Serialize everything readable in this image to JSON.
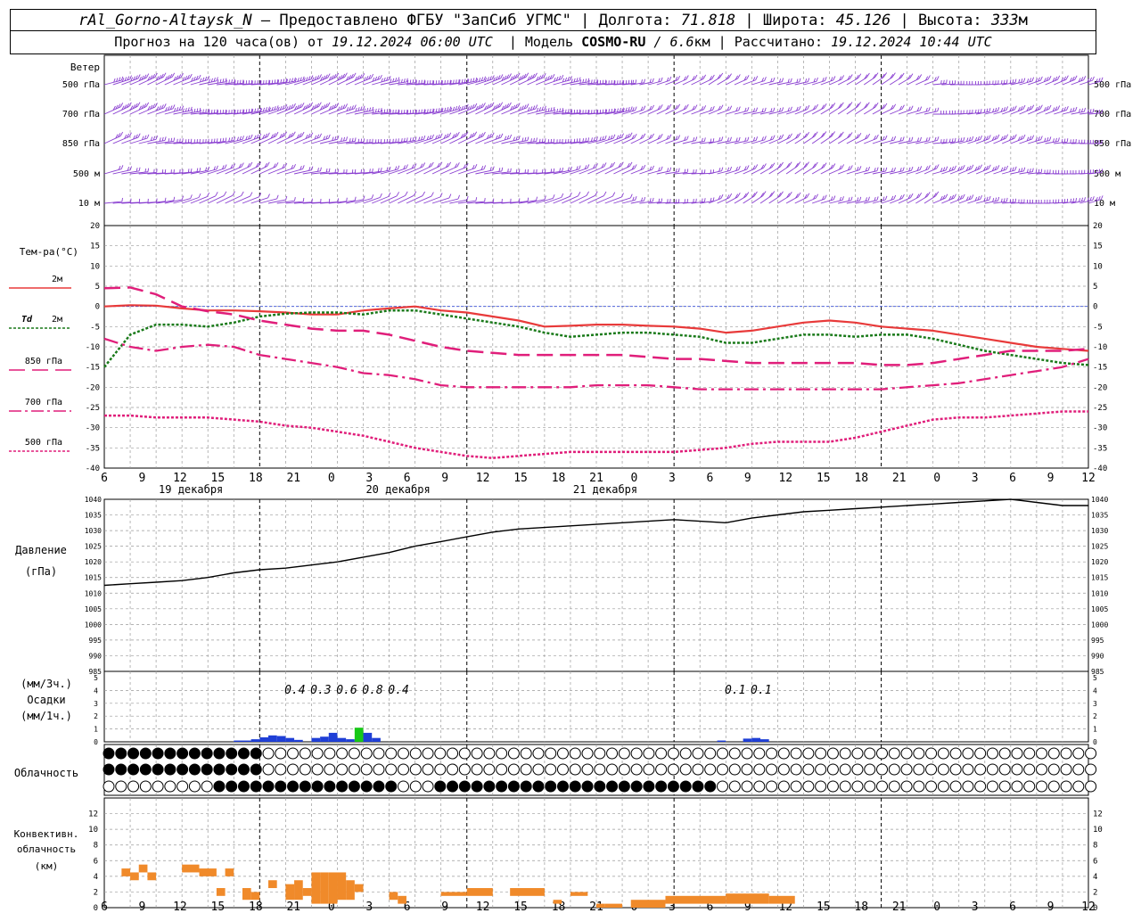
{
  "header": {
    "station": "rAl_Gorno-Altaysk_N",
    "provider": "— Предоставлено ФГБУ \"ЗапСиб УГМС\"",
    "lon_label": "| Долгота:",
    "lon_value": "71.818",
    "lat_label": "| Широта:",
    "lat_value": "45.126",
    "alt_label": "| Высота:",
    "alt_value": "333",
    "alt_unit": "м",
    "forecast_label": "Прогноз на 120 часа(ов) от",
    "forecast_from": "19.12.2024 06:00 UTC",
    "model_label": "| Модель",
    "model_name": "COSMO-RU",
    "model_res": "/ 6.6",
    "model_res_unit": "км",
    "calc_label": "| Рассчитано:",
    "calc_time": "19.12.2024 10:44 UTC"
  },
  "colors": {
    "wind": "#8a3fd1",
    "t2m": "#e83a3a",
    "td2m": "#1a7a1a",
    "t850": "#e01e7a",
    "t700": "#e01e7a",
    "t500": "#e01e7a",
    "zero_line": "#3a50d8",
    "pressure": "#000000",
    "precip_blue": "#1f3fd6",
    "precip_green": "#18c818",
    "conv_cloud": "#f08a2a",
    "grid": "#9a9a9a"
  },
  "wind_panel": {
    "title": "Ветер",
    "levels": [
      "500 гПа",
      "700 гПа",
      "850 гПа",
      "500 м",
      "10 м"
    ]
  },
  "temp_panel": {
    "title": "Тем-ра(°C)",
    "legend": {
      "t2m": "2м",
      "td_sym": "Td",
      "td": "2м",
      "t850": "850 гПа",
      "t700": "700 гПа",
      "t500": "500 гПа"
    }
  },
  "time_axis": {
    "tick_labels": [
      "6",
      "9",
      "12",
      "15",
      "18",
      "21",
      "0",
      "3",
      "6",
      "9",
      "12",
      "15",
      "18",
      "21",
      "0",
      "3",
      "6",
      "9",
      "12",
      "15",
      "18",
      "21",
      "0",
      "3",
      "6",
      "9",
      "12"
    ],
    "day_labels": [
      "19 декабря",
      "20 декабря",
      "21 декабря"
    ]
  },
  "pressure_panel": {
    "title": "Давление",
    "unit": "(гПа)"
  },
  "precip_panel": {
    "unit3": "(мм/3ч.)",
    "title": "Осадки",
    "unit1": "(мм/1ч.)",
    "totals": [
      {
        "hour": 21,
        "value": "0.4"
      },
      {
        "hour": 24,
        "value": "0.3"
      },
      {
        "hour": 27,
        "value": "0.6"
      },
      {
        "hour": 30,
        "value": "0.8"
      },
      {
        "hour": 33,
        "value": "0.4"
      },
      {
        "hour": 72,
        "value": "0.1"
      },
      {
        "hour": 75,
        "value": "0.1"
      }
    ]
  },
  "cloud_panel": {
    "title": "Облачность"
  },
  "conv_panel": {
    "title_line1": "Конвективн.",
    "title_line2": "облачность",
    "unit": "(км)"
  },
  "chart_data": [
    {
      "type": "line",
      "name": "temperature",
      "x_unit": "hours since 19.12.2024 06:00 UTC",
      "ylim": [
        -40,
        20
      ],
      "y_ticks": [
        20,
        15,
        10,
        5,
        0,
        -5,
        -10,
        -15,
        -20,
        -25,
        -30,
        -35,
        -40
      ],
      "x": [
        0,
        3,
        6,
        9,
        12,
        15,
        18,
        21,
        24,
        27,
        30,
        33,
        36,
        39,
        42,
        45,
        48,
        51,
        54,
        57,
        60,
        63,
        66,
        69,
        72,
        75,
        78,
        81,
        84,
        87,
        90,
        93,
        96,
        99,
        102,
        105,
        108,
        111,
        114
      ],
      "series": [
        {
          "key": "t2m",
          "values": [
            0,
            0.3,
            0.2,
            -0.5,
            -1,
            -1,
            -1.2,
            -1.5,
            -2,
            -2,
            -1,
            -0.5,
            0,
            -1,
            -1.5,
            -2.5,
            -3.5,
            -5,
            -4.8,
            -4.5,
            -4.5,
            -4.8,
            -5,
            -5.5,
            -6.5,
            -6,
            -5,
            -4,
            -3.5,
            -4,
            -5,
            -5.5,
            -6,
            -7,
            -8,
            -9,
            -10,
            -10.5,
            -11
          ]
        },
        {
          "key": "td2m",
          "values": [
            -15,
            -7,
            -4.5,
            -4.5,
            -5,
            -4,
            -2.5,
            -1.8,
            -1.5,
            -1.5,
            -2,
            -1,
            -1,
            -2,
            -3,
            -4,
            -5,
            -6.5,
            -7.5,
            -7,
            -6.5,
            -6.5,
            -7,
            -7.5,
            -9,
            -9,
            -8,
            -7,
            -7,
            -7.5,
            -7,
            -7,
            -8,
            -9.5,
            -11,
            -12,
            -13,
            -14,
            -14.5
          ]
        },
        {
          "key": "t850",
          "values": [
            4.5,
            4.7,
            3,
            0,
            -1.2,
            -2,
            -3.5,
            -4.5,
            -5.5,
            -6,
            -6,
            -7,
            -8.5,
            -10,
            -11,
            -11.5,
            -12,
            -12,
            -12,
            -12,
            -12,
            -12.5,
            -13,
            -13,
            -13.5,
            -14,
            -14,
            -14,
            -14,
            -14,
            -14.5,
            -14.5,
            -14,
            -13,
            -12,
            -11,
            -11,
            -11,
            -10.5
          ]
        },
        {
          "key": "t700",
          "values": [
            -8,
            -10,
            -11,
            -10,
            -9.5,
            -10,
            -12,
            -13,
            -14,
            -15,
            -16.5,
            -17,
            -18,
            -19.5,
            -20,
            -20,
            -20,
            -20,
            -20,
            -19.5,
            -19.5,
            -19.5,
            -20,
            -20.5,
            -20.5,
            -20.5,
            -20.5,
            -20.5,
            -20.5,
            -20.5,
            -20.5,
            -20,
            -19.5,
            -19,
            -18,
            -17,
            -16,
            -15,
            -13
          ]
        },
        {
          "key": "t500",
          "values": [
            -27,
            -27,
            -27.5,
            -27.5,
            -27.5,
            -28,
            -28.5,
            -29.5,
            -30,
            -31,
            -32,
            -33.5,
            -35,
            -36,
            -37,
            -37.5,
            -37,
            -36.5,
            -36,
            -36,
            -36,
            -36,
            -36,
            -35.5,
            -35,
            -34,
            -33.5,
            -33.5,
            -33.5,
            -32.5,
            -31,
            -29.5,
            -28,
            -27.5,
            -27.5,
            -27,
            -26.5,
            -26,
            -26
          ]
        }
      ]
    },
    {
      "type": "line",
      "name": "pressure",
      "ylim": [
        985,
        1040
      ],
      "y_ticks": [
        1040,
        1035,
        1030,
        1025,
        1020,
        1015,
        1010,
        1005,
        1000,
        995,
        990,
        985
      ],
      "x": [
        0,
        3,
        6,
        9,
        12,
        15,
        18,
        21,
        24,
        27,
        30,
        33,
        36,
        39,
        42,
        45,
        48,
        51,
        54,
        57,
        60,
        63,
        66,
        69,
        72,
        75,
        78,
        81,
        84,
        87,
        90,
        93,
        96,
        99,
        102,
        105,
        108,
        111,
        114
      ],
      "values": [
        1012.5,
        1013,
        1013.5,
        1014,
        1015,
        1016.5,
        1017.5,
        1018,
        1019,
        1020,
        1021.5,
        1023,
        1025,
        1026.5,
        1028,
        1029.5,
        1030.5,
        1031,
        1031.5,
        1032,
        1032.5,
        1033,
        1033.5,
        1033,
        1032.5,
        1034,
        1035,
        1036,
        1036.5,
        1037,
        1037.5,
        1038,
        1038.5,
        1039,
        1039.5,
        1040,
        1039,
        1038,
        1038
      ]
    },
    {
      "type": "bar",
      "name": "precipitation",
      "ylim": [
        0,
        5
      ],
      "y_ticks": [
        5,
        4,
        3,
        2,
        1,
        0
      ],
      "bars": [
        {
          "x": 15,
          "w": 2,
          "v": 0.1,
          "c": "blue"
        },
        {
          "x": 17,
          "w": 1,
          "v": 0.2,
          "c": "blue"
        },
        {
          "x": 18,
          "w": 1,
          "v": 0.35,
          "c": "blue"
        },
        {
          "x": 19,
          "w": 1,
          "v": 0.5,
          "c": "blue"
        },
        {
          "x": 20,
          "w": 1,
          "v": 0.45,
          "c": "blue"
        },
        {
          "x": 21,
          "w": 1,
          "v": 0.3,
          "c": "blue"
        },
        {
          "x": 22,
          "w": 1,
          "v": 0.15,
          "c": "blue"
        },
        {
          "x": 24,
          "w": 1,
          "v": 0.3,
          "c": "blue"
        },
        {
          "x": 25,
          "w": 1,
          "v": 0.4,
          "c": "blue"
        },
        {
          "x": 26,
          "w": 1,
          "v": 0.7,
          "c": "blue"
        },
        {
          "x": 27,
          "w": 1,
          "v": 0.3,
          "c": "blue"
        },
        {
          "x": 28,
          "w": 1,
          "v": 0.2,
          "c": "blue"
        },
        {
          "x": 29,
          "w": 1,
          "v": 1.1,
          "c": "green"
        },
        {
          "x": 30,
          "w": 1,
          "v": 0.7,
          "c": "blue"
        },
        {
          "x": 31,
          "w": 1,
          "v": 0.3,
          "c": "blue"
        },
        {
          "x": 71,
          "w": 1,
          "v": 0.1,
          "c": "blue"
        },
        {
          "x": 74,
          "w": 1,
          "v": 0.25,
          "c": "blue"
        },
        {
          "x": 75,
          "w": 1,
          "v": 0.3,
          "c": "blue"
        },
        {
          "x": 76,
          "w": 1,
          "v": 0.2,
          "c": "blue"
        }
      ]
    },
    {
      "type": "bar",
      "name": "convective_cloud",
      "ylim": [
        0,
        14
      ],
      "y_ticks": [
        12,
        10,
        8,
        6,
        4,
        2,
        0
      ],
      "bars": [
        {
          "x": 2,
          "w": 1,
          "b": 4,
          "t": 5
        },
        {
          "x": 3,
          "w": 1,
          "b": 3.5,
          "t": 4.5
        },
        {
          "x": 4,
          "w": 1,
          "b": 4.5,
          "t": 5.5
        },
        {
          "x": 5,
          "w": 1,
          "b": 3.5,
          "t": 4.5
        },
        {
          "x": 9,
          "w": 2,
          "b": 4.5,
          "t": 5.5
        },
        {
          "x": 11,
          "w": 2,
          "b": 4,
          "t": 5
        },
        {
          "x": 14,
          "w": 1,
          "b": 4,
          "t": 5
        },
        {
          "x": 13,
          "w": 1,
          "b": 1.5,
          "t": 2.5
        },
        {
          "x": 16,
          "w": 1,
          "b": 1,
          "t": 2.5
        },
        {
          "x": 17,
          "w": 1,
          "b": 1,
          "t": 2
        },
        {
          "x": 19,
          "w": 1,
          "b": 2.5,
          "t": 3.5
        },
        {
          "x": 21,
          "w": 1,
          "b": 1,
          "t": 3
        },
        {
          "x": 22,
          "w": 1,
          "b": 1,
          "t": 3.5
        },
        {
          "x": 23,
          "w": 1,
          "b": 1.5,
          "t": 2.5
        },
        {
          "x": 24,
          "w": 1,
          "b": 0.5,
          "t": 4.5
        },
        {
          "x": 25,
          "w": 1,
          "b": 0.5,
          "t": 4.5
        },
        {
          "x": 26,
          "w": 1,
          "b": 0.5,
          "t": 4.5
        },
        {
          "x": 27,
          "w": 1,
          "b": 1,
          "t": 4.5
        },
        {
          "x": 28,
          "w": 1,
          "b": 1,
          "t": 3.5
        },
        {
          "x": 29,
          "w": 1,
          "b": 2,
          "t": 3
        },
        {
          "x": 33,
          "w": 1,
          "b": 1,
          "t": 2
        },
        {
          "x": 34,
          "w": 1,
          "b": 0.5,
          "t": 1.5
        },
        {
          "x": 39,
          "w": 3,
          "b": 1.5,
          "t": 2
        },
        {
          "x": 42,
          "w": 3,
          "b": 1.5,
          "t": 2.5
        },
        {
          "x": 47,
          "w": 4,
          "b": 1.5,
          "t": 2.5
        },
        {
          "x": 52,
          "w": 1,
          "b": 0.5,
          "t": 1
        },
        {
          "x": 54,
          "w": 2,
          "b": 1.5,
          "t": 2
        },
        {
          "x": 57,
          "w": 1,
          "b": 0,
          "t": 0.5
        },
        {
          "x": 58,
          "w": 2,
          "b": 0,
          "t": 0.5
        },
        {
          "x": 61,
          "w": 4,
          "b": 0,
          "t": 1
        },
        {
          "x": 65,
          "w": 7,
          "b": 0.5,
          "t": 1.5
        },
        {
          "x": 72,
          "w": 5,
          "b": 0.5,
          "t": 1.8
        },
        {
          "x": 77,
          "w": 3,
          "b": 0.5,
          "t": 1.5
        }
      ]
    }
  ]
}
